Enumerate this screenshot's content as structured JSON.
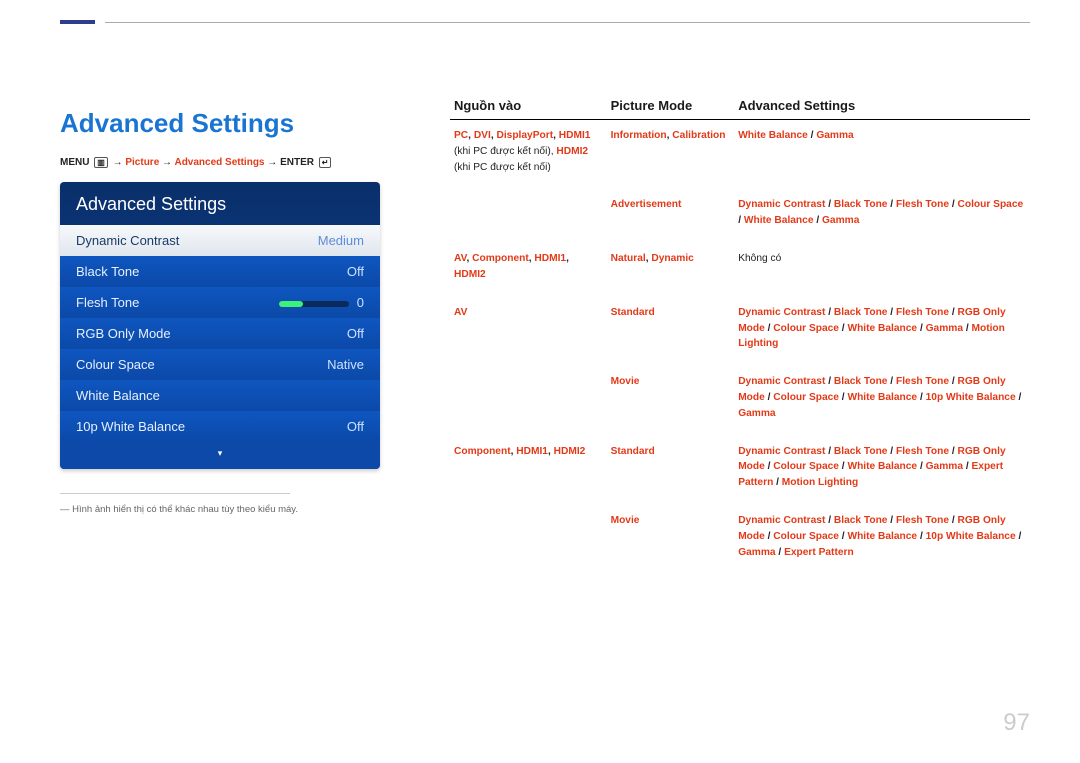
{
  "page_number": "97",
  "heading": "Advanced Settings",
  "breadcrumb": {
    "menu": "MENU",
    "menu_icon": "▥",
    "arrow": "→",
    "picture": "Picture",
    "adv": "Advanced Settings",
    "enter": "ENTER",
    "enter_icon": "↵"
  },
  "osd": {
    "title": "Advanced Settings",
    "rows": [
      {
        "label": "Dynamic Contrast",
        "value": "Medium",
        "selected": true
      },
      {
        "label": "Black Tone",
        "value": "Off"
      },
      {
        "label": "Flesh Tone",
        "value": "0",
        "slider": true
      },
      {
        "label": "RGB Only Mode",
        "value": "Off"
      },
      {
        "label": "Colour Space",
        "value": "Native"
      },
      {
        "label": "White Balance",
        "value": ""
      },
      {
        "label": "10p White Balance",
        "value": "Off"
      }
    ],
    "foot_icon": "▾"
  },
  "footnote": "― Hình ảnh hiển thị có thể khác nhau tùy theo kiểu máy.",
  "table": {
    "headers": [
      "Nguồn vào",
      "Picture Mode",
      "Advanced Settings"
    ],
    "rows": [
      {
        "source_html": "<span class='r'>PC</span><span class='b'>, </span><span class='r'>DVI</span><span class='b'>, </span><span class='r'>DisplayPort</span><span class='b'>, </span><span class='r'>HDMI1</span><span class='plain'> (khi PC được kết nối), </span><span class='r'>HDMI2</span><span class='plain'> (khi PC được kết nối)</span>",
        "mode_html": "<span class='r'>Information</span><span class='b'>, </span><span class='r'>Calibration</span>",
        "adv_html": "<span class='r'>White Balance</span><span class='b'> / </span><span class='r'>Gamma</span>"
      },
      {
        "source_html": "",
        "mode_html": "<span class='r'>Advertisement</span>",
        "adv_html": "<span class='r'>Dynamic Contrast</span><span class='b'> / </span><span class='r'>Black Tone</span><span class='b'> / </span><span class='r'>Flesh Tone</span><span class='b'> / </span><span class='r'>Colour Space</span><span class='b'> / </span><span class='r'>White Balance</span><span class='b'> / </span><span class='r'>Gamma</span>"
      },
      {
        "source_html": "<span class='r'>AV</span><span class='b'>, </span><span class='r'>Component</span><span class='b'>, </span><span class='r'>HDMI1</span><span class='b'>, </span><span class='r'>HDMI2</span>",
        "mode_html": "<span class='r'>Natural</span><span class='b'>, </span><span class='r'>Dynamic</span>",
        "adv_html": "<span class='plain'>Không có</span>"
      },
      {
        "source_html": "<span class='r'>AV</span>",
        "mode_html": "<span class='r'>Standard</span>",
        "adv_html": "<span class='r'>Dynamic Contrast</span><span class='b'> / </span><span class='r'>Black Tone</span><span class='b'> / </span><span class='r'>Flesh Tone</span><span class='b'> / </span><span class='r'>RGB Only Mode</span><span class='b'> / </span><span class='r'>Colour Space</span><span class='b'> / </span><span class='r'>White Balance</span><span class='b'> / </span><span class='r'>Gamma</span><span class='b'> / </span><span class='r'>Motion Lighting</span>"
      },
      {
        "source_html": "",
        "mode_html": "<span class='r'>Movie</span>",
        "adv_html": "<span class='r'>Dynamic Contrast</span><span class='b'> / </span><span class='r'>Black Tone</span><span class='b'> / </span><span class='r'>Flesh Tone</span><span class='b'> / </span><span class='r'>RGB Only Mode</span><span class='b'> / </span><span class='r'>Colour Space</span><span class='b'> / </span><span class='r'>White Balance</span><span class='b'> / </span><span class='r'>10p White Balance</span><span class='b'> / </span><span class='r'>Gamma</span>"
      },
      {
        "source_html": "<span class='r'>Component</span><span class='b'>, </span><span class='r'>HDMI1</span><span class='b'>, </span><span class='r'>HDMI2</span>",
        "mode_html": "<span class='r'>Standard</span>",
        "adv_html": "<span class='r'>Dynamic Contrast</span><span class='b'> / </span><span class='r'>Black Tone</span><span class='b'> / </span><span class='r'>Flesh Tone</span><span class='b'> / </span><span class='r'>RGB Only Mode</span><span class='b'> / </span><span class='r'>Colour Space</span><span class='b'> / </span><span class='r'>White Balance</span><span class='b'> / </span><span class='r'>Gamma</span><span class='b'> / </span><span class='r'>Expert Pattern</span><span class='b'> / </span><span class='r'>Motion Lighting</span>"
      },
      {
        "source_html": "",
        "mode_html": "<span class='r'>Movie</span>",
        "adv_html": "<span class='r'>Dynamic Contrast</span><span class='b'> / </span><span class='r'>Black Tone</span><span class='b'> / </span><span class='r'>Flesh Tone</span><span class='b'> / </span><span class='r'>RGB Only Mode</span><span class='b'> / </span><span class='r'>Colour Space</span><span class='b'> / </span><span class='r'>White Balance</span><span class='b'> / </span><span class='r'>10p White Balance</span><span class='b'> / </span><span class='r'>Gamma</span><span class='b'> / </span><span class='r'>Expert Pattern</span>"
      }
    ]
  }
}
